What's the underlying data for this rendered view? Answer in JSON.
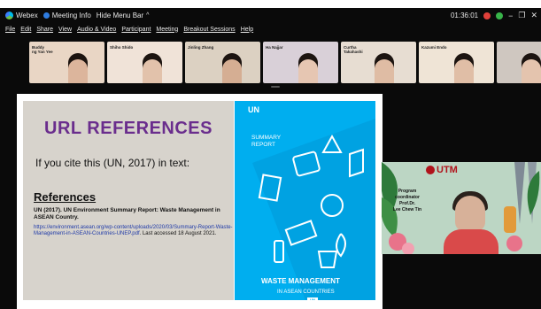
{
  "titlebar": {
    "app_name": "Webex",
    "meeting_info": "Meeting Info",
    "hide_menu": "Hide Menu Bar",
    "caret": "^",
    "timer": "01:36:01",
    "minimize": "−",
    "restore": "❐",
    "close": "✕"
  },
  "menu": [
    "File",
    "Edit",
    "Share",
    "View",
    "Audio & Video",
    "Participant",
    "Meeting",
    "Breakout Sessions",
    "Help"
  ],
  "participants": [
    {
      "name_line1": "Buddy",
      "name_line2": "ng Yan Yee",
      "bg": "#e9d6c5",
      "shirt": "#c25b5b"
    },
    {
      "name_line1": "Shiho Shido",
      "name_line2": "",
      "bg": "#f0e3d8",
      "shirt": "#e8e8e8"
    },
    {
      "name_line1": "Jinling Zhang",
      "name_line2": "",
      "bg": "#dcd1c2",
      "shirt": "#4b4b52"
    },
    {
      "name_line1": "Ha Najjar",
      "name_line2": "",
      "bg": "#d9d0d8",
      "shirt": "#2e2e33"
    },
    {
      "name_line1": "Curtha",
      "name_line2": "Takahashi",
      "bg": "#e7ddd2",
      "shirt": "#8a8f7a"
    },
    {
      "name_line1": "Kazumi Endo",
      "name_line2": "",
      "bg": "#efe4d6",
      "shirt": "#4d6a58"
    },
    {
      "name_line1": "",
      "name_line2": "",
      "bg": "#cfc7c0",
      "shirt": "#3b3b3b"
    }
  ],
  "slide": {
    "title": "URL REFERENCES",
    "cite_text": "If you cite this (UN, 2017) in text:",
    "references_heading": "References",
    "reference_body": "UN (2017). UN Environment Summary Report: Waste Management in ASEAN Country.",
    "reference_url": "https://environment.asean.org/wp-content/uploads/2020/03/Summary-Report-Waste-Management-in-ASEAN-Countries-UNEP.pdf",
    "reference_accessed": ". Last accessed 18 August 2021.",
    "cover": {
      "badge": "UN",
      "summary_line1": "SUMMARY",
      "summary_line2": "REPORT",
      "waste_title": "WASTE MANAGEMENT",
      "waste_subtitle": "IN ASEAN COUNTRIES",
      "badge_small": "UN"
    }
  },
  "speaker": {
    "role_line1": "Program",
    "role_line2": "coordinator",
    "name_line1": "Prof.Dr.",
    "name_line2": "Lee Chew Tin",
    "logo_text": "UTM"
  },
  "colors": {
    "slide_title": "#6a2d8d",
    "cover_blue": "#00aeef",
    "link": "#1f3aa8"
  }
}
